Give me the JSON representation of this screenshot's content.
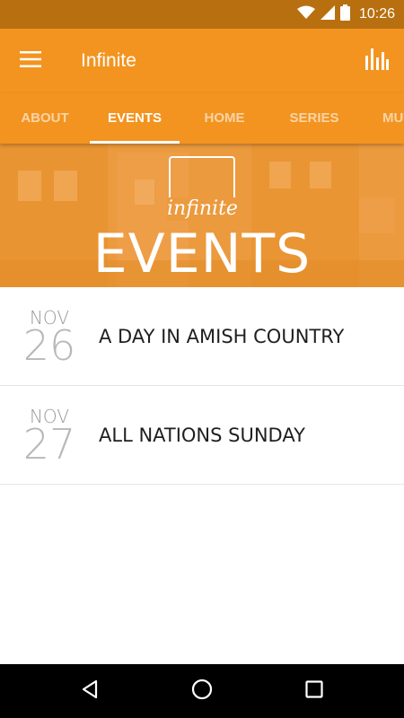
{
  "status_bar": {
    "time": "10:26",
    "icons": [
      "wifi-icon",
      "cell-signal-icon",
      "battery-icon"
    ]
  },
  "app_bar": {
    "title": "Infinite",
    "menu_icon": "hamburger-menu-icon",
    "action_icon": "bar-chart-icon"
  },
  "tabs": {
    "items": [
      {
        "label": "ABOUT"
      },
      {
        "label": "EVENTS"
      },
      {
        "label": "HOME"
      },
      {
        "label": "SERIES"
      },
      {
        "label": "MU"
      }
    ],
    "active_index": 1
  },
  "banner": {
    "logo_text": "infinite",
    "title": "EVENTS"
  },
  "events": [
    {
      "month": "NOV",
      "day": "26",
      "title": "A DAY IN AMISH COUNTRY"
    },
    {
      "month": "NOV",
      "day": "27",
      "title": "ALL NATIONS SUNDAY"
    }
  ],
  "nav_bar": {
    "icons": [
      "back-icon",
      "home-icon",
      "recents-icon"
    ]
  },
  "colors": {
    "primary": "#f39420",
    "status_bar": "#b86f0f",
    "banner": "#eb9a3e"
  }
}
